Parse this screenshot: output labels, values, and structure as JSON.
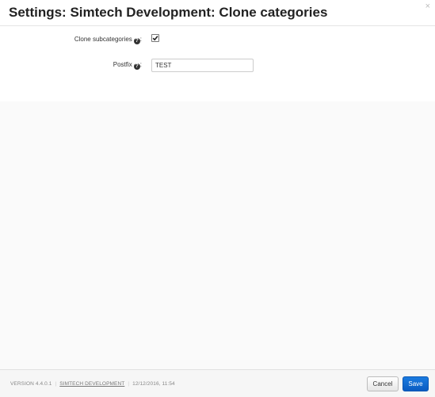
{
  "dialog": {
    "title": "Settings: Simtech Development: Clone categories",
    "close_glyph": "×"
  },
  "form": {
    "clone_subcategories": {
      "label": "Clone subcategories",
      "help_glyph": "?",
      "colon": ":",
      "checked": true
    },
    "postfix": {
      "label": "Postfix",
      "help_glyph": "?",
      "colon": ":",
      "value": "TEST"
    }
  },
  "footer": {
    "version": "VERSION 4.4.0.1",
    "company": "SIMTECH DEVELOPMENT",
    "datetime": "12/12/2016, 11:54",
    "separator": "|",
    "cancel_label": "Cancel",
    "save_label": "Save"
  },
  "colors": {
    "primary": "#0a5cc1",
    "body_background": "#fafafa"
  },
  "icons": {
    "close": "close-icon",
    "help": "question-circle-icon",
    "check": "checkmark-icon"
  }
}
